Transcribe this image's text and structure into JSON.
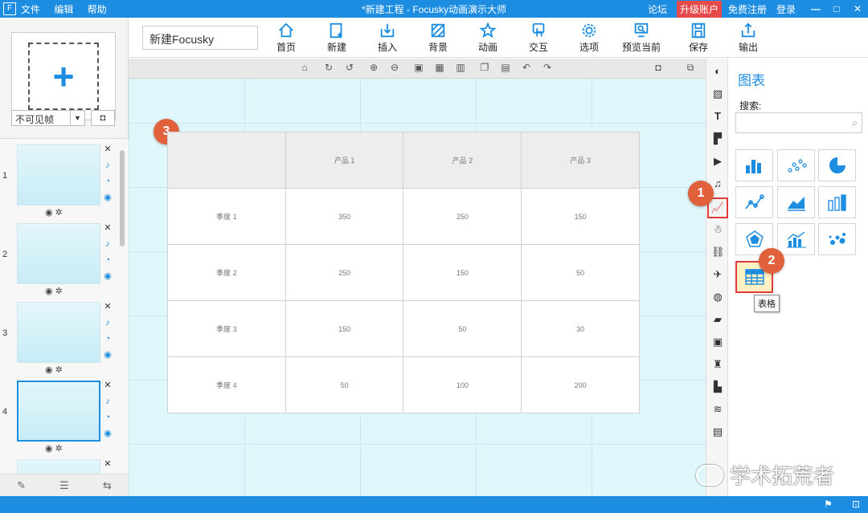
{
  "titlebar": {
    "logo": "F",
    "menus": [
      "文件",
      "编辑",
      "帮助"
    ],
    "title": "*新建工程 - Focusky动画演示大师",
    "forum": "论坛",
    "upgrade": "升级账户",
    "register": "免费注册",
    "login": "登录",
    "minimize": "—",
    "maximize": "□",
    "close": "✕"
  },
  "toolbar": {
    "project_name": "新建Focusky",
    "buttons": [
      "首页",
      "新建",
      "插入",
      "背景",
      "动画",
      "交互",
      "选项",
      "预览当前",
      "保存",
      "输出"
    ]
  },
  "left": {
    "frame_select": "不可见帧",
    "thumbs": [
      {
        "num": "1"
      },
      {
        "num": "2"
      },
      {
        "num": "3"
      },
      {
        "num": "4"
      }
    ]
  },
  "canvas": {
    "badges": {
      "one": "1",
      "two": "2",
      "three": "3"
    },
    "table": {
      "headers": [
        "",
        "产品 1",
        "产品 2",
        "产品 3"
      ],
      "rows": [
        [
          "季度 1",
          "350",
          "250",
          "150"
        ],
        [
          "季度 2",
          "250",
          "150",
          "50"
        ],
        [
          "季度 3",
          "150",
          "50",
          "30"
        ],
        [
          "季度 4",
          "50",
          "100",
          "200"
        ]
      ]
    }
  },
  "rightpanel": {
    "title": "图表",
    "search_label": "搜索:",
    "tooltip": "表格"
  },
  "watermark": "学术拓荒者",
  "colors": {
    "accent": "#1c8de0",
    "badge": "#e0613c",
    "highlight": "#e03b3b",
    "canvas_bg": "#dff6fa"
  }
}
